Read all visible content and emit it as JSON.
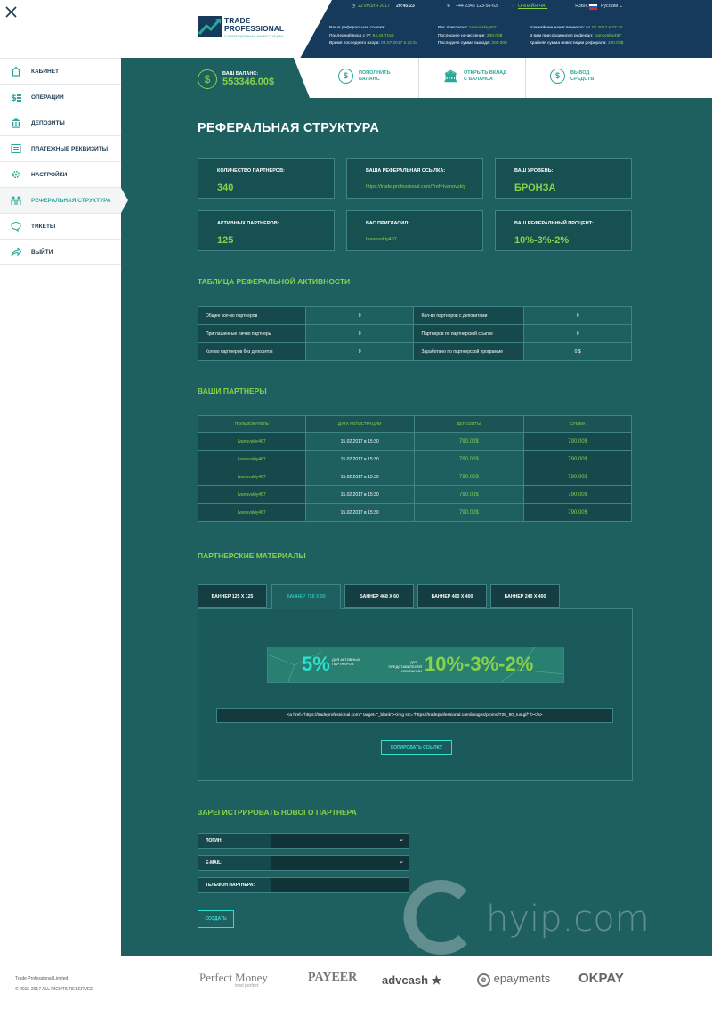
{
  "sidebar": {
    "items": [
      {
        "label": "КАБИНЕТ",
        "icon": "home-icon"
      },
      {
        "label": "ОПЕРАЦИИ",
        "icon": "coins-icon"
      },
      {
        "label": "ДЕПОЗИТЫ",
        "icon": "bank-icon"
      },
      {
        "label": "ПЛАТЕЖНЫЕ РЕКВИЗИТЫ",
        "icon": "document-icon"
      },
      {
        "label": "НАСТРОЙКИ",
        "icon": "gear-icon"
      },
      {
        "label": "РЕФЕРАЛЬНАЯ СТРУКТУРА",
        "icon": "referral-icon",
        "active": true
      },
      {
        "label": "ТИКЕТЫ",
        "icon": "chat-icon"
      },
      {
        "label": "ВЫЙТИ",
        "icon": "exit-icon"
      }
    ],
    "footer_company": "Trade Professional Limited",
    "footer_rights": "© 2015-2017 ALL RIGHTS RESERVED"
  },
  "header": {
    "logo_title": "TRADE PROFESSIONAL",
    "logo_subtitle": "СОВМЕЩЕННЫЕ ИНВЕСТИЦИИ",
    "date": "22 ИЮЛЯ 2017",
    "time": "20:45:23",
    "phone": "+44 2345 123-56-63",
    "online_chat": "ОНЛАЙН ЧАТ",
    "lang_label": "ЯЗЫК:",
    "lang_value": "Русский",
    "info_col1": [
      {
        "label": "Ваша реферальная ссылка:",
        "value": ""
      },
      {
        "label": "Последний вход с IP:",
        "value": "94.44.7158"
      },
      {
        "label": "Время последнего входа:",
        "value": "04.07.2017 в 22:34"
      }
    ],
    "info_col2": [
      {
        "label": "Вас пригласил:",
        "value": "Ivanovskiy467"
      },
      {
        "label": "Последнее начисление:",
        "value": "200.00$"
      },
      {
        "label": "Последняя сумма вывода:",
        "value": "200.00$"
      }
    ],
    "info_col3": [
      {
        "label": "Ближайшее начисление по:",
        "value": "04.07.2017 в 22:34"
      },
      {
        "label": "В вам присоединился реферал:",
        "value": "Ivanovskiy467"
      },
      {
        "label": "Крайняя сумма инвестиции реферала:",
        "value": "200.00$"
      }
    ]
  },
  "actions": {
    "balance_label": "ВАШ БАЛАНС:",
    "balance_value": "553346.00$",
    "deposit_line1": "ПОПОЛНИТЬ",
    "deposit_line2": "БАЛАНС",
    "open_line1": "ОТКРЫТЬ ВКЛАД",
    "open_line2": "С БАЛАНСА",
    "withdraw_line1": "ВЫВОД",
    "withdraw_line2": "СРЕДСТВ"
  },
  "page_title": "РЕФЕРАЛЬНАЯ СТРУКТУРА",
  "cards": [
    {
      "label": "КОЛИЧЕСТВО ПАРТНЕРОВ:",
      "value": "340"
    },
    {
      "label": "ВАША РЕФЕРАЛЬНАЯ ССЫЛКА:",
      "value": "https://trade-professional.com/?ref=Ivanovskiy"
    },
    {
      "label": "ВАШ УРОВЕНЬ:",
      "value": "БРОНЗА"
    },
    {
      "label": "АКТИВНЫХ ПАРТНЕРОВ:",
      "value": "125"
    },
    {
      "label": "ВАС ПРИГЛАСИЛ:",
      "value": "Ivanovskiy467"
    },
    {
      "label": "ВАШ РЕФЕРАЛЬНЫЙ ПРОЦЕНТ:",
      "value": "10%-3%-2%"
    }
  ],
  "activity": {
    "title": "ТАБЛИЦА РЕФЕРАЛЬНОЙ АКТИВНОСТИ",
    "rows": [
      [
        "Общее кол-во партнеров",
        "0",
        "Кол-во партнеров с депозитами",
        "0"
      ],
      [
        "Приглашенные лично партнеры",
        "0",
        "Партнеров по партнерской ссылке",
        "0"
      ],
      [
        "Кол-во партнеров без депозитов",
        "0",
        "Заработано по партнерской программе",
        "0 $"
      ]
    ]
  },
  "partners": {
    "title": "ВАШИ ПАРТНЕРЫ",
    "headers": [
      "ПОЛЬЗОВАТЕЛЬ",
      "ДАТА РЕГИСТРАЦИИ",
      "ДЕПОЗИТЫ",
      "СУММА"
    ],
    "rows": [
      [
        "Ivanovskiy467",
        "15.02.2017 в 15:30",
        "790.00$",
        "790.00$"
      ],
      [
        "Ivanovskiy467",
        "15.02.2017 в 15:30",
        "790.00$",
        "790.00$"
      ],
      [
        "Ivanovskiy467",
        "15.02.2017 в 15:30",
        "790.00$",
        "790.00$"
      ],
      [
        "Ivanovskiy467",
        "15.02.2017 в 15:30",
        "790.00$",
        "790.00$"
      ],
      [
        "Ivanovskiy467",
        "15.02.2017 в 15:30",
        "790.00$",
        "790.00$"
      ]
    ]
  },
  "materials": {
    "title": "ПАРТНЕРСКИЕ МАТЕРИАЛЫ",
    "tabs": [
      "БАННЕР 125 X 125",
      "БАННЕР 728 X 90",
      "БАННЕР 468 X 60",
      "БАННЕР 400 X 400",
      "БАННЕР 240 X 400"
    ],
    "banner": {
      "pct1": "5%",
      "txt1": "ДЛЯ АКТИВНЫХ ПАРТНЕРОВ",
      "txt2a": "ДЛЯ",
      "txt2b": "ПРЕДСТАВИТЕЛЕЙ КОМПАНИИ",
      "pct2": "10%-3%-2%"
    },
    "code": "<a href=\"https://tradeprofessional.com/\" target=\"_blank\"><img src=\"https://tradeprofessional.com/images/promo/728_90_rus.gif\" /></a>",
    "copy_button": "КОПИРОВАТЬ ССЫЛКУ"
  },
  "register": {
    "title": "ЗАРЕГИСТРИРОВАТЬ НОВОГО ПАРТНЕРА",
    "login_label": "ЛОГИН:",
    "email_label": "E-MAIL:",
    "phone_label": "ТЕЛЕФОН ПАРТНЕРА:",
    "submit": "СОЗДАТЬ"
  },
  "payments": {
    "perfect_money": "Perfect Money",
    "perfect_money_tag": "trust perfect",
    "payeer": "PAYEER",
    "advcash": "advcash",
    "epayments": "epayments",
    "okpay": "OKPAY"
  },
  "watermark": "hyip.com",
  "colors": {
    "accent_green": "#86d24a",
    "accent_teal": "#2aa89a",
    "navy": "#153a5c",
    "bg": "#1e5f60"
  }
}
